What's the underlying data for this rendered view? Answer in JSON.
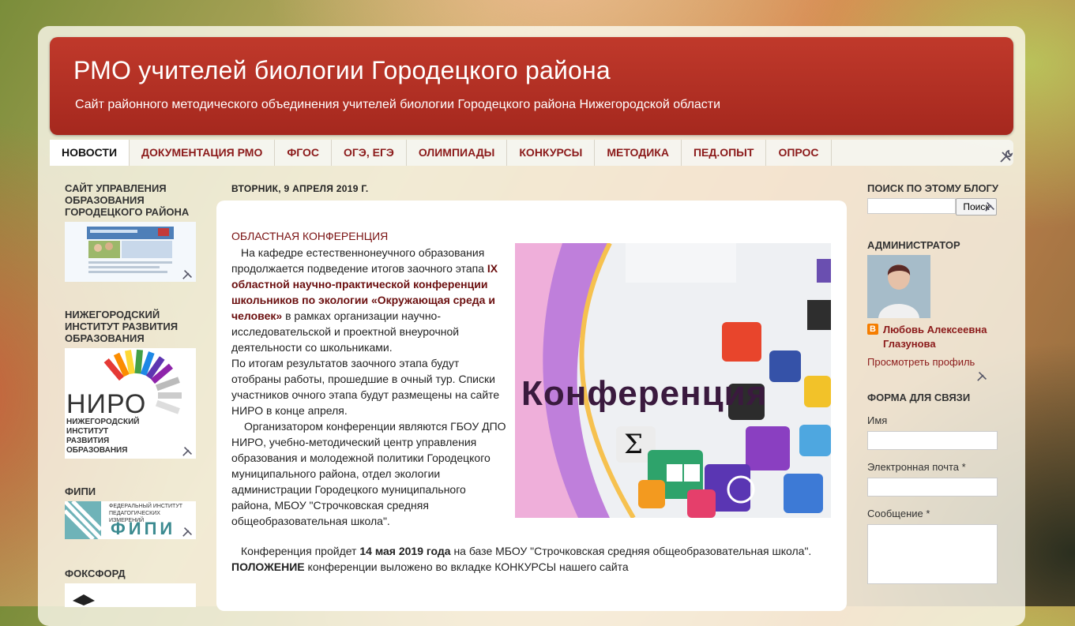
{
  "header": {
    "title": "РМО учителей биологии Городецкого района",
    "description": "Сайт районного методического объединения учителей биологии Городецкого района Нижегородской области"
  },
  "nav": {
    "tabs": [
      "НОВОСТИ",
      "ДОКУМЕНТАЦИЯ РМО",
      "ФГОС",
      "ОГЭ, ЕГЭ",
      "ОЛИМПИАДЫ",
      "КОНКУРСЫ",
      "МЕТОДИКА",
      "ПЕД.ОПЫТ",
      "ОПРОС"
    ],
    "active": "НОВОСТИ"
  },
  "left_sidebar": {
    "widget1_title": "САЙТ УПРАВЛЕНИЯ ОБРАЗОВАНИЯ ГОРОДЕЦКОГО РАЙОНА",
    "widget2_title": "НИЖЕГОРОДСКИЙ ИНСТИТУТ РАЗВИТИЯ ОБРАЗОВАНИЯ",
    "niro_logo_big": "НИРО",
    "niro_logo_small": "НИЖЕГОРОДСКИЙ ИНСТИТУТ РАЗВИТИЯ ОБРАЗОВАНИЯ",
    "widget3_title": "ФИПИ",
    "fipi_logo_small": "ФЕДЕРАЛЬНЫЙ ИНСТИТУТ ПЕДАГОГИЧЕСКИХ ИЗМЕРЕНИЙ",
    "fipi_logo_big": "ФИПИ",
    "widget4_title": "ФОКСФОРД"
  },
  "post": {
    "date": "ВТОРНИК, 9 АПРЕЛЯ 2019 Г.",
    "title": "ОБЛАСТНАЯ КОНФЕРЕНЦИЯ",
    "p1_start": "На кафедре естественнонеучного образования продолжается подведение итогов заочного этапа ",
    "p1_bold": "IX областной научно-практической конференции школьников по экологии «Окружающая среда и человек»",
    "p1_end": " в рамках организации научно-исследовательской и проектной внеурочной деятельности со школьниками.",
    "p2": "По итогам результатов заочного этапа будут отобраны работы, прошедшие в очный тур. Списки участников очного этапа будут размещены на сайте НИРО в конце апреля.",
    "p3": "Организатором конференции являются ГБОУ ДПО НИРО, учебно-методический центр управления образования и молодежной политики Городецкого муниципального района, отдел экологии администрации Городецкого муниципального района, МБОУ \"Строчковская средняя общеобразовательная школа\".",
    "p4_start": "Конференция пройдет ",
    "p4_bold": "14 мая 2019 года",
    "p4_end": " на базе МБОУ \"Строчковская средняя общеобразовательная школа\".",
    "p5_bold": "ПОЛОЖЕНИЕ",
    "p5_end": " конференции выложено во вкладке КОНКУРСЫ нашего сайта",
    "image_word": "Конференция"
  },
  "right_sidebar": {
    "search_title": "ПОИСК ПО ЭТОМУ БЛОГУ",
    "search_button": "Поиск",
    "admin_title": "АДМИНИСТРАТОР",
    "admin_name": "Любовь Алексеевна Глазунова",
    "view_profile": "Просмотреть профиль",
    "contact_title": "ФОРМА ДЛЯ СВЯЗИ",
    "name_label": "Имя",
    "email_label": "Электронная почта *",
    "message_label": "Сообщение *"
  },
  "icons": {
    "wrench": "wrench-screwdriver-icon",
    "blogger": "blogger-icon"
  },
  "colors": {
    "header_red": "#b03226",
    "link_red": "#8b1a1a",
    "blogger_orange": "#f57d00"
  }
}
